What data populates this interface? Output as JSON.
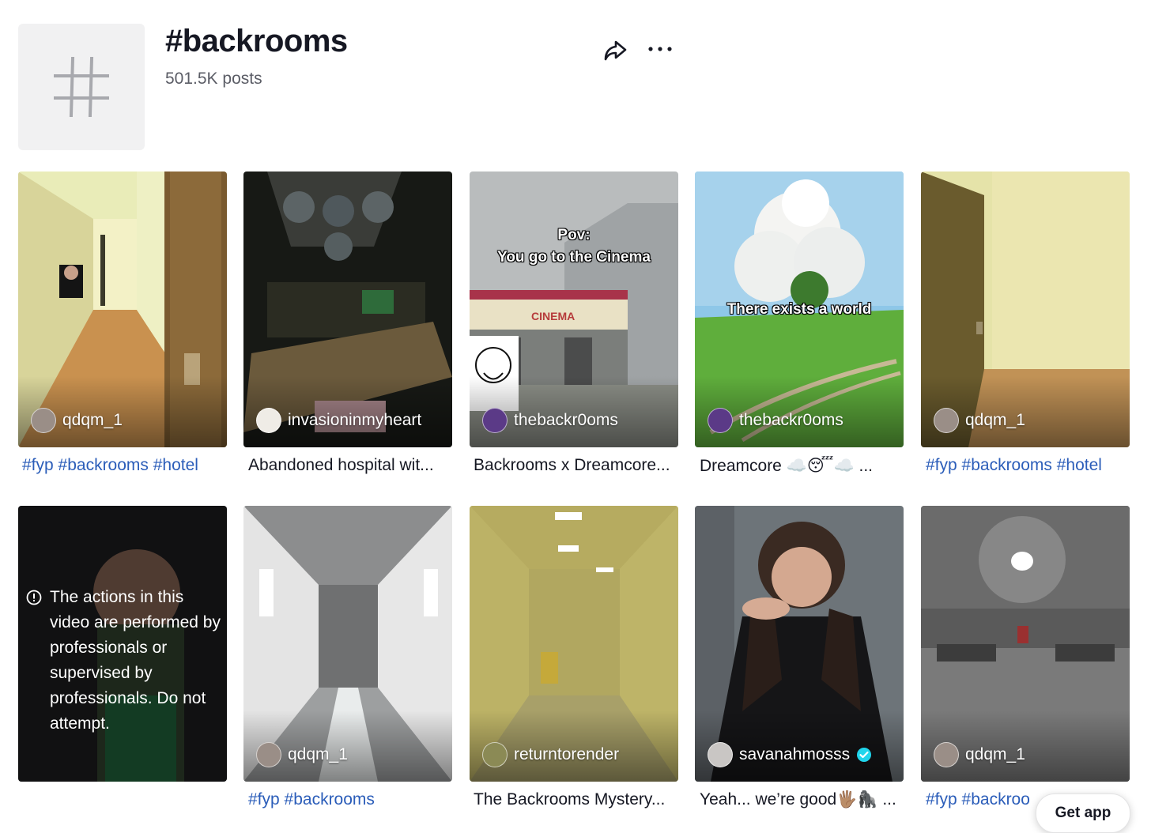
{
  "header": {
    "title": "#backrooms",
    "posts": "501.5K posts",
    "icon": "hashtag-icon"
  },
  "actions": {
    "share_icon": "share-icon",
    "more_icon": "more-icon"
  },
  "videos": [
    {
      "author": "qdqm_1",
      "caption": "#fyp #backrooms #hotel"
    },
    {
      "author": "invasioninmyheart",
      "caption": "Abandoned hospital wit..."
    },
    {
      "author": "thebackr0oms",
      "caption": "Backrooms x Dreamcore...",
      "overlay": [
        "Pov:",
        "You go to the Cinema"
      ],
      "sign": "CINEMA"
    },
    {
      "author": "thebackr0oms",
      "caption": "Dreamcore ☁️😴☁️ ...",
      "overlay": [
        "There exists a world"
      ]
    },
    {
      "author": "qdqm_1",
      "caption": "#fyp #backrooms #hotel"
    },
    {
      "author": "",
      "caption": "",
      "warning": "The actions in this video are performed by professionals or supervised by professionals. Do not attempt."
    },
    {
      "author": "qdqm_1",
      "caption": "#fyp #backrooms"
    },
    {
      "author": "returntorender",
      "caption": "The Backrooms Mystery..."
    },
    {
      "author": "savanahmosss",
      "caption": "Yeah... we’re good🖐🏽🦍 ..."
    },
    {
      "author": "qdqm_1",
      "caption": "#fyp #backroo"
    }
  ],
  "get_app": "Get app",
  "colors": {
    "hashtag_link": "#2b5db9",
    "text": "#161823",
    "muted": "#5b5d66"
  }
}
